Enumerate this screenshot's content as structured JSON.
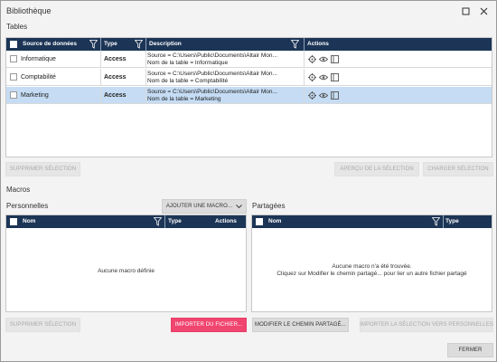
{
  "window": {
    "title": "Bibliothèque"
  },
  "tables": {
    "section_label": "Tables",
    "columns": {
      "source": "Source de données",
      "type": "Type",
      "description": "Description",
      "actions": "Actions"
    },
    "rows": [
      {
        "source": "Informatique",
        "type": "Access",
        "desc_line1": "Source = C:\\Users\\Public\\Documents\\Altair Mon...",
        "desc_line2": "Nom de la table = Informatique",
        "selected": false
      },
      {
        "source": "Comptabilité",
        "type": "Access",
        "desc_line1": "Source = C:\\Users\\Public\\Documents\\Altair Mon...",
        "desc_line2": "Nom de la table = Comptabilité",
        "selected": false
      },
      {
        "source": "Marketing",
        "type": "Access",
        "desc_line1": "Source = C:\\Users\\Public\\Documents\\Altair Mon...",
        "desc_line2": "Nom de la table = Marketing",
        "selected": true
      }
    ],
    "buttons": {
      "delete_selection": "SUPPRIMER SÉLECTION",
      "preview_selection": "APERÇU DE LA SÉLECTION",
      "load_selection": "CHARGER SÉLECTION"
    }
  },
  "macros": {
    "section_label": "Macros",
    "personal": {
      "label": "Personnelles",
      "add_macro_label": "AJOUTER UNE MACRO...",
      "columns": {
        "name": "Nom",
        "type": "Type",
        "actions": "Actions"
      },
      "empty_text": "Aucune macro définie"
    },
    "shared": {
      "label": "Partagées",
      "columns": {
        "name": "Nom",
        "type": "Type"
      },
      "empty_line1": "Aucune macro n'a été trouvée.",
      "empty_line2": "Cliquez sur Modifier le chemin partagé... pour lier un autre fichier partagé"
    },
    "buttons": {
      "delete_selection": "SUPPRIMER SÉLECTION",
      "import_file": "IMPORTER DU FICHIER...",
      "modify_shared_path": "MODIFIER LE CHEMIN PARTAGÉ...",
      "import_to_personal": "IMPORTER LA SÉLECTION VERS PERSONNELLES"
    }
  },
  "footer": {
    "close_label": "FERMER"
  },
  "colors": {
    "header_bg": "#1c3556",
    "selected_row": "#c5dcf4",
    "import_button": "#f0456f"
  },
  "icons": [
    "maximize-icon",
    "close-icon",
    "filter-icon",
    "settings-gear-icon",
    "preview-eye-icon",
    "table-panel-icon",
    "chevron-down-icon"
  ]
}
